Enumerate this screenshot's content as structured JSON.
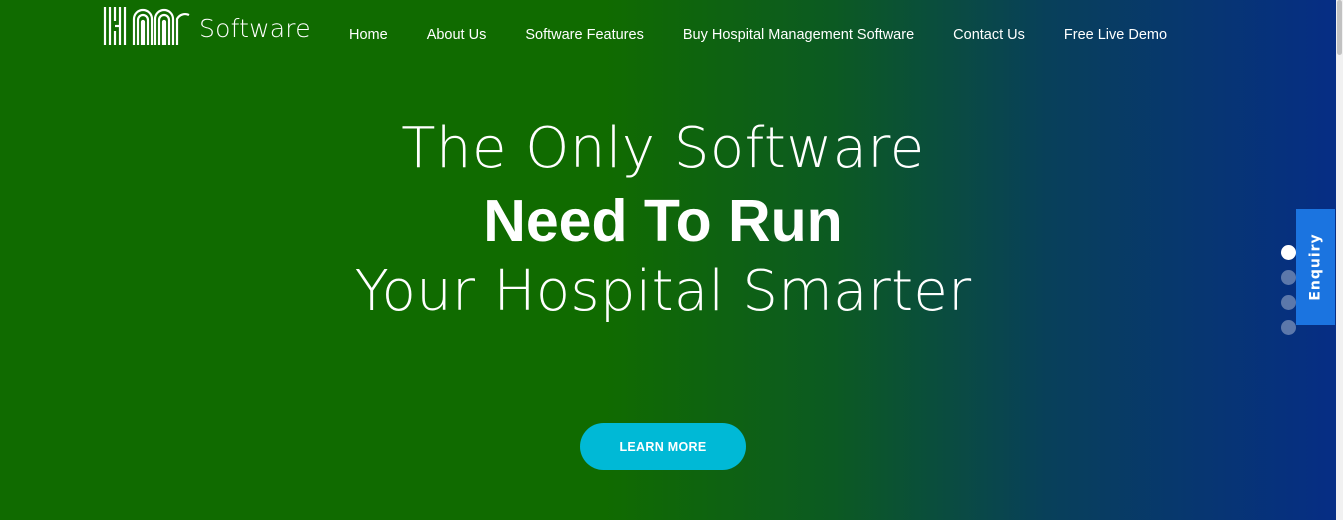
{
  "header": {
    "logo_mark": "HM",
    "logo_text": "Software",
    "nav": [
      {
        "label": "Home"
      },
      {
        "label": "About Us"
      },
      {
        "label": "Software Features"
      },
      {
        "label": "Buy Hospital Management Software"
      },
      {
        "label": "Contact Us"
      },
      {
        "label": "Free Live Demo"
      }
    ]
  },
  "hero": {
    "line1": "The Only Software",
    "line2": "Need To Run",
    "line3": "Your Hospital Smarter",
    "cta_label": "LEARN MORE",
    "slide_count": 4,
    "active_slide": 1
  },
  "enquiry_tab": {
    "label": "Enquiry"
  },
  "colors": {
    "gradient_start": "#106b00",
    "gradient_end": "#062d86",
    "cta_bg": "#00b9d6",
    "enquiry_bg": "#1b74e0"
  }
}
